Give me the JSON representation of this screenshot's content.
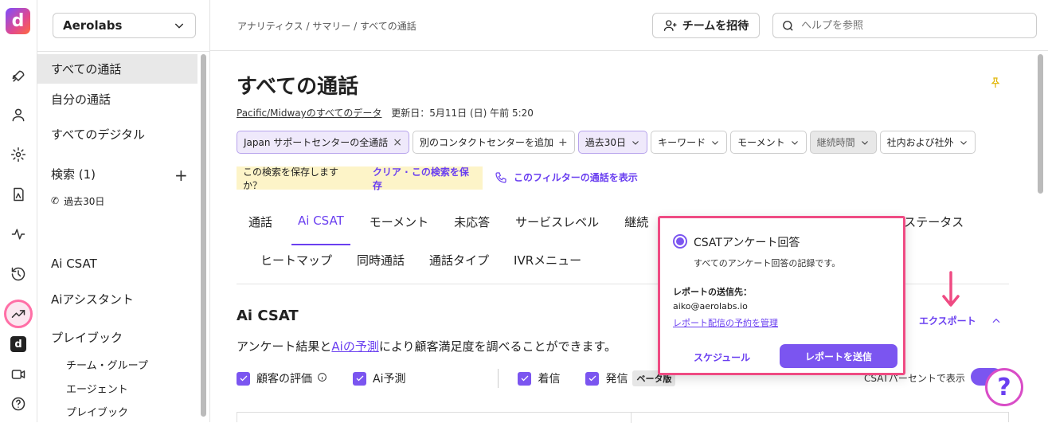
{
  "rail": {
    "logo": "d",
    "small_logo": "d"
  },
  "sidebar": {
    "workspace": "Aerolabs",
    "items": [
      {
        "label": "すべての通話"
      },
      {
        "label": "自分の通話"
      },
      {
        "label": "すべてのデジタル"
      },
      {
        "label": "検索 (1)"
      },
      {
        "label": "過去30日"
      },
      {
        "label": "Ai CSAT"
      },
      {
        "label": "Aiアシスタント"
      },
      {
        "label": "プレイブック"
      },
      {
        "label": "チーム・グループ"
      },
      {
        "label": "エージェント"
      },
      {
        "label": "プレイブック"
      }
    ],
    "plus": "+"
  },
  "header": {
    "breadcrumb": "アナリティクス / サマリー / すべての通話",
    "invite_label": "チームを招待",
    "search_placeholder": "ヘルプを参照"
  },
  "page": {
    "title": "すべての通話",
    "meta_link": "Pacific/Midwayのすべてのデータ",
    "meta_updated": "更新日：5月11日 (日) 午前 5:20",
    "chips": [
      {
        "label": "Japan サポートセンターの全通話",
        "suffix": "×"
      },
      {
        "label": "別のコンタクトセンターを追加",
        "suffix": "+"
      },
      {
        "label": "過去30日"
      },
      {
        "label": "キーワード"
      },
      {
        "label": "モーメント"
      },
      {
        "label": "継続時間"
      },
      {
        "label": "社内および社外"
      }
    ],
    "save_prompt": "この検索を保存しますか？",
    "save_links": "クリア · この検索を保存",
    "show_calls": "このフィルターの通話を表示",
    "tabs_row1": [
      "通話",
      "Ai CSAT",
      "モーメント",
      "未応答",
      "サービスレベル",
      "継続",
      "トステータス"
    ],
    "tabs_row2": [
      "ヒートマップ",
      "同時通話",
      "通話タイプ",
      "IVRメニュー"
    ],
    "section_title": "Ai CSAT",
    "desc_pre": "アンケート結果と",
    "desc_link": "Aiの予測",
    "desc_post": "により顧客満足度を調べることができます。",
    "checks": [
      "顧客の評価",
      "Ai予測",
      "着信",
      "発信"
    ],
    "beta": "ベータ版",
    "export": "エクスポート",
    "pct_label": "CSATパーセントで表示"
  },
  "popover": {
    "title": "CSATアンケート回答",
    "subtitle": "すべてのアンケート回答の記録です。",
    "recipient_label": "レポートの送信先：",
    "email": "aiko@aerolabs.io",
    "manage_link": "レポート配信の予約を管理",
    "schedule": "スケジュール",
    "send": "レポートを送信"
  },
  "help": "?",
  "colors": {
    "accent": "#7b55f0",
    "highlight": "#ef4b83"
  }
}
